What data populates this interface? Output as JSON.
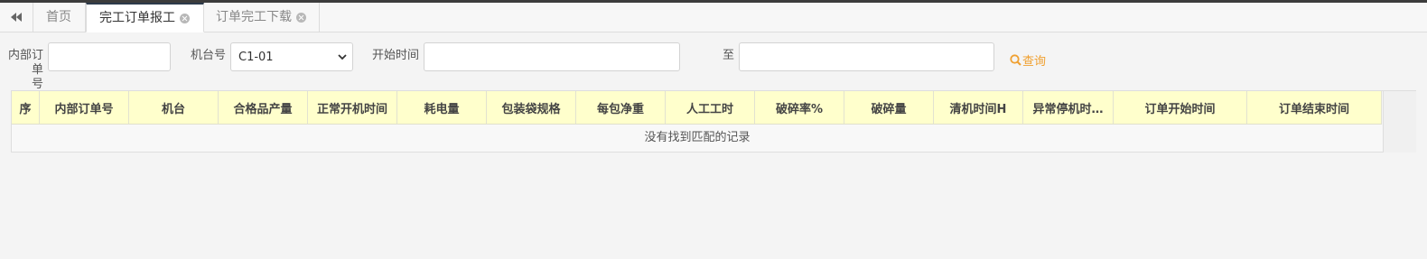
{
  "tabs": [
    {
      "label": "首页",
      "active": false,
      "closable": false
    },
    {
      "label": "完工订单报工",
      "active": true,
      "closable": true
    },
    {
      "label": "订单完工下载",
      "active": false,
      "closable": true
    }
  ],
  "form": {
    "order_label_line1": "内部订单",
    "order_label_line2": "号",
    "order_value": "",
    "machine_label": "机台号",
    "machine_selected": "C1-01",
    "start_label": "开始时间",
    "start_value": "",
    "to_label": "至",
    "end_value": "",
    "query_label": "查询"
  },
  "table": {
    "columns": [
      "序",
      "内部订单号",
      "机台",
      "合格品产量",
      "正常开机时间",
      "耗电量",
      "包装袋规格",
      "每包净重",
      "人工工时",
      "破碎率%",
      "破碎量",
      "清机时间H",
      "异常停机时…",
      "订单开始时间",
      "订单结束时间"
    ],
    "empty_message": "没有找到匹配的记录"
  },
  "colors": {
    "accent": "#f0a030",
    "header_bg": "#ffffcc"
  }
}
